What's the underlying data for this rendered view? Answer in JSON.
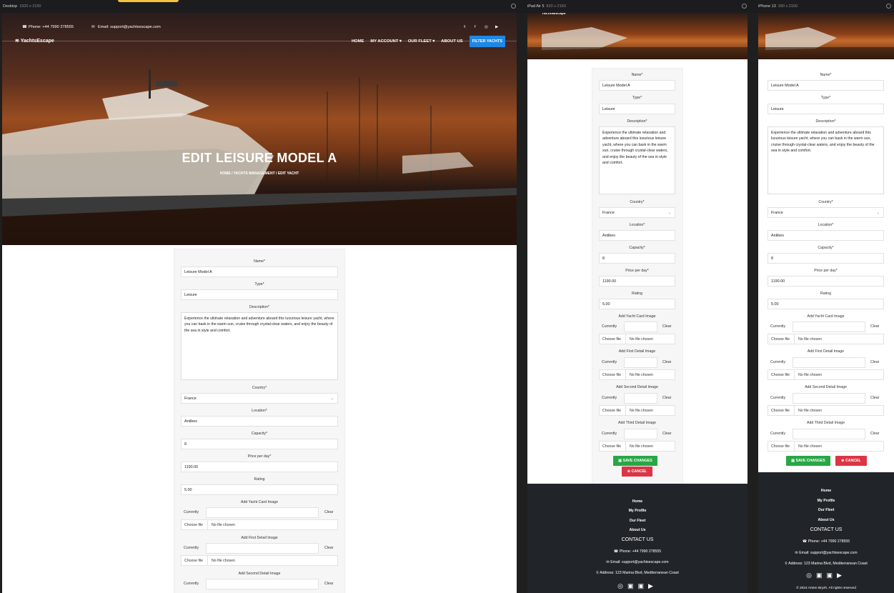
{
  "viewports": {
    "desktop": {
      "name": "Desktop",
      "size": "1920 x 2160"
    },
    "ipad": {
      "name": "iPad Air 5",
      "size": "820 x 2160"
    },
    "iphone": {
      "name": "iPhone 13",
      "size": "390 x 2160"
    }
  },
  "header": {
    "phone": "Phone: +44 7990 278555",
    "email": "Email: support@yachtsescape.com",
    "logo": "YachtsEscape",
    "nav": {
      "home": "HOME",
      "account": "MY ACCOUNT",
      "fleet": "OUR FLEET",
      "about": "ABOUT US",
      "filter": "FILTER YACHTS"
    },
    "social_icons": [
      "twitter-icon",
      "facebook-icon",
      "instagram-icon",
      "youtube-icon"
    ]
  },
  "hero": {
    "title": "EDIT LEISURE MODEL A",
    "breadcrumb": "HOME  /  YACHTS MANAGEMENT  /  EDIT YACHT"
  },
  "form": {
    "name_label": "Name*",
    "name_value": "Leisure Model A",
    "type_label": "Type*",
    "type_value": "Leisure",
    "description_label": "Description*",
    "description_value": "Experience the ultimate relaxation and adventure aboard this luxurious leisure yacht, where you can bask in the warm sun, cruise through crystal-clear waters, and enjoy the beauty of the sea in style and comfort.",
    "country_label": "Country*",
    "country_value": "France",
    "location_label": "Location*",
    "location_value": "Antibes",
    "capacity_label": "Capacity*",
    "capacity_value": "8",
    "price_label": "Price per day*",
    "price_value": "1190.00",
    "rating_label": "Rating",
    "rating_value": "5.00",
    "card_image_label": "Add Yacht Card Image",
    "first_image_label": "Add First Detail Image",
    "second_image_label": "Add Second Detail Image",
    "third_image_label": "Add Third Detail Image",
    "currently": "Currently",
    "clear": "Clear",
    "choose_file": "Choose file",
    "no_file": "No file chosen",
    "save": "SAVE CHANGES",
    "cancel": "CANCEL"
  },
  "footer": {
    "links": [
      "Home",
      "My Profile",
      "Our Fleet",
      "About Us"
    ],
    "contact_heading": "CONTACT US",
    "phone": "Phone: +44 7990 278555",
    "email": "Email: support@yachtsescape.com",
    "address": "Address: 123 Marina Blvd, Mediterranean Coast",
    "copyright": "© 2024   Artem Bryzh.   All rights reserved"
  },
  "colors": {
    "primary_blue": "#1e88e5",
    "save_green": "#28a745",
    "cancel_red": "#dc3545",
    "footer_dark": "#212529"
  }
}
